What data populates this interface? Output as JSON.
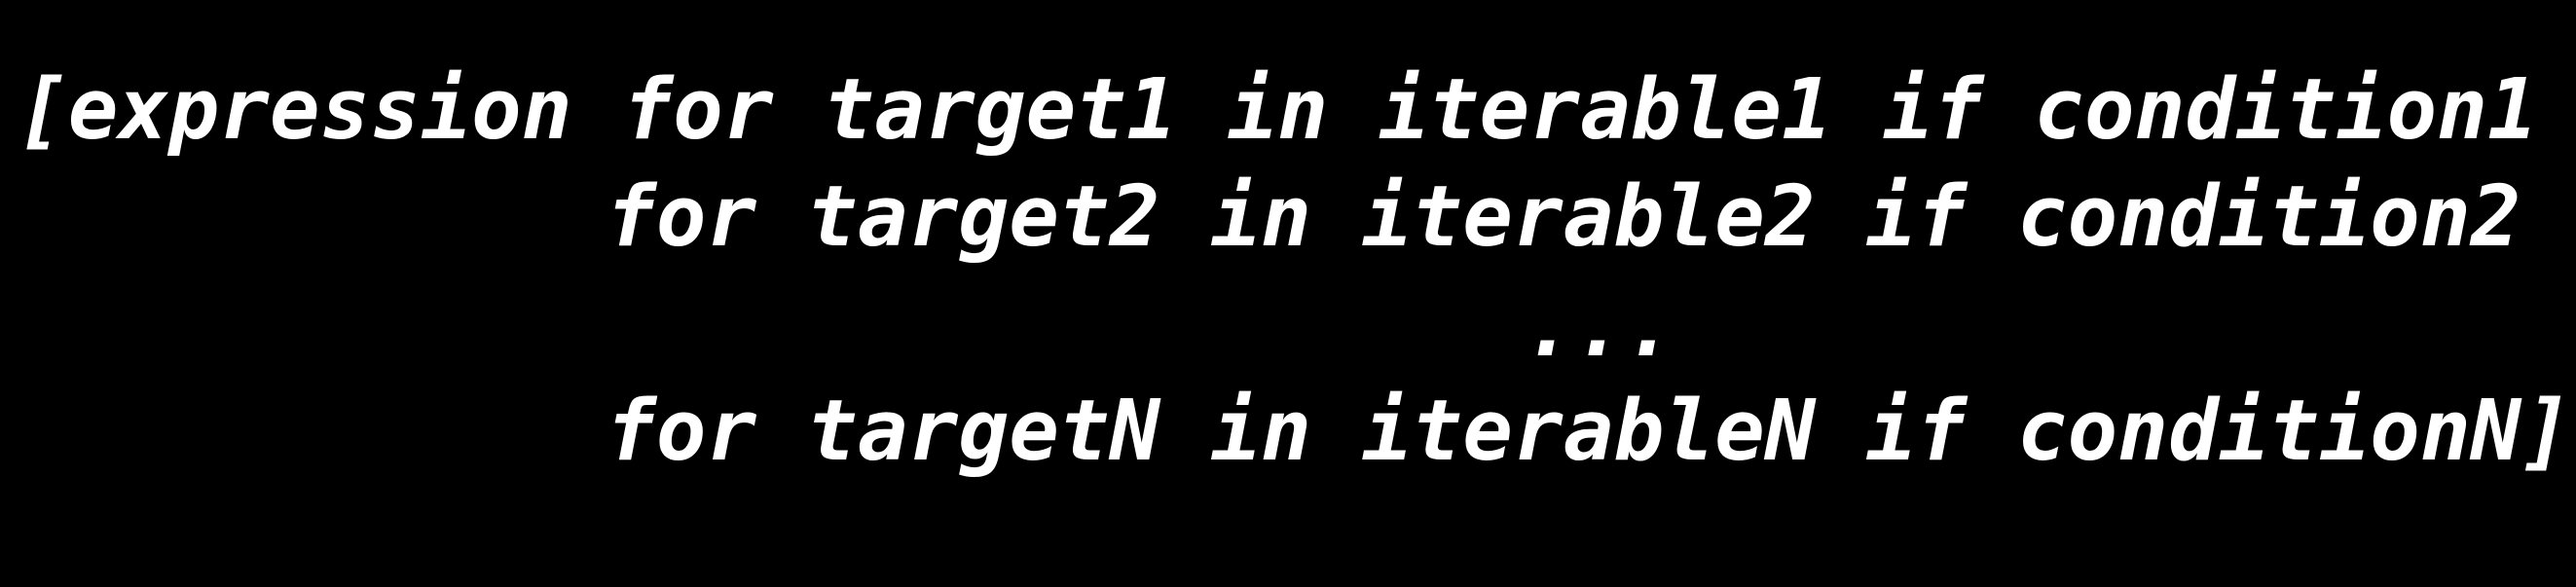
{
  "code": {
    "line1": "[expression for target1 in iterable1 if condition1",
    "line2": "for target2 in iterable2 if condition2",
    "line3": "...",
    "line4": "for targetN in iterableN if conditionN]"
  },
  "colors": {
    "background": "#000000",
    "text": "#ffffff"
  }
}
